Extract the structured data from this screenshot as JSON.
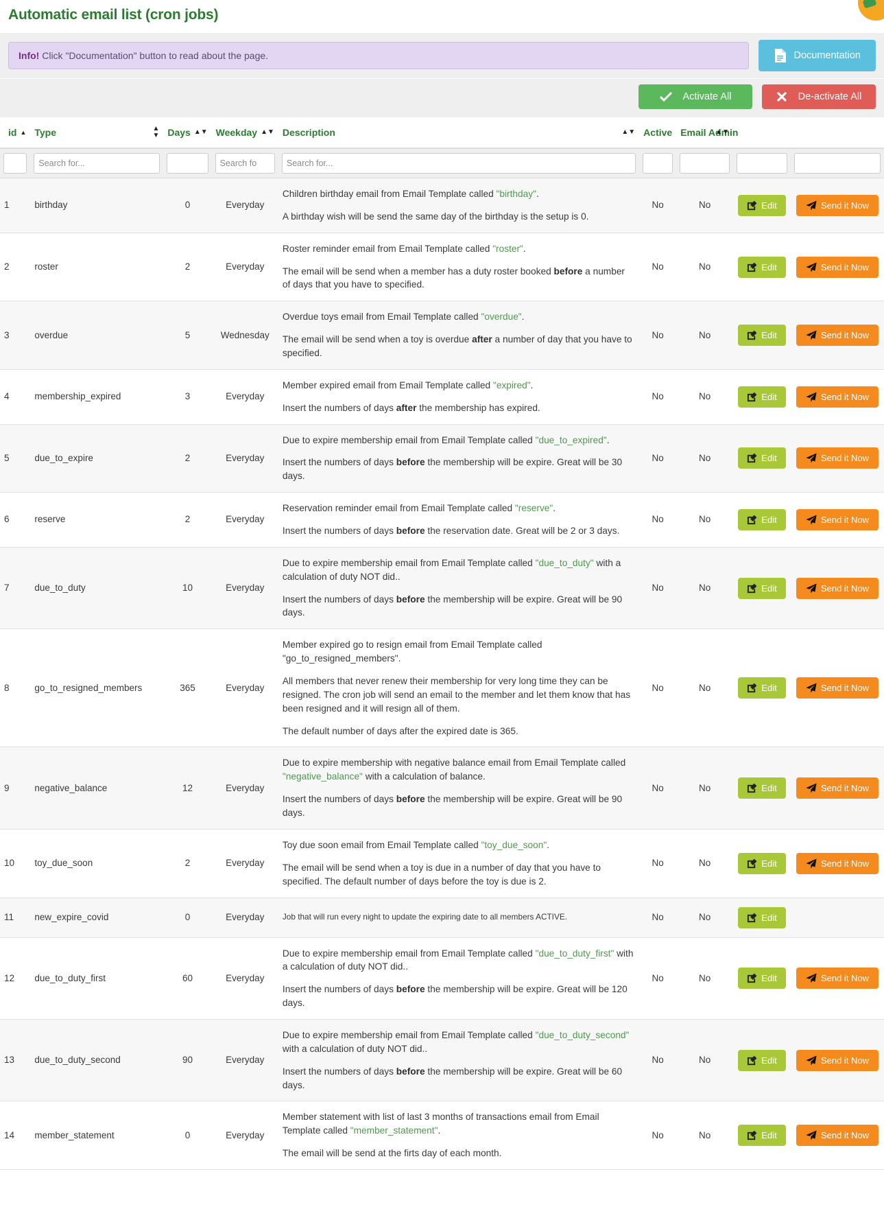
{
  "page": {
    "title": "Automatic email list (cron jobs)",
    "corner_badge_icon": "notification-badge-icon"
  },
  "alert": {
    "prefix": "Info!",
    "message": " Click \"Documentation\" button to read about the page."
  },
  "toolbar": {
    "documentation_label": "Documentation",
    "documentation_icon": "document-icon",
    "activate_all_label": "Activate All",
    "activate_all_icon": "check-icon",
    "deactivate_all_label": "De-activate All",
    "deactivate_all_icon": "cross-icon"
  },
  "table": {
    "headers": {
      "id": "id",
      "type": "Type",
      "days": "Days",
      "weekday": "Weekday",
      "description": "Description",
      "active": "Active",
      "email_admin": "Email Admin"
    },
    "filters": {
      "id_placeholder": "",
      "type_placeholder": "Search for...",
      "days_placeholder": "",
      "weekday_placeholder": "Search fo",
      "description_placeholder": "Search for...",
      "active_placeholder": "",
      "email_admin_placeholder": "",
      "edit_placeholder": "",
      "send_placeholder": ""
    },
    "row_buttons": {
      "edit_label": "Edit",
      "edit_icon": "pencil-square-icon",
      "send_label": "Send it Now",
      "send_icon": "paper-plane-icon"
    },
    "rows": [
      {
        "id": "1",
        "type": "birthday",
        "days": "0",
        "weekday": "Everyday",
        "description_lines": [
          [
            {
              "t": "Children birthday email from Email Template called "
            },
            {
              "t": "\"birthday\"",
              "s": "tpl"
            },
            {
              "t": "."
            }
          ],
          [
            {
              "t": "A birthday wish will be send the same day of the birthday is the setup is 0."
            }
          ]
        ],
        "active": "No",
        "email_admin": "No",
        "has_send": true,
        "small": false
      },
      {
        "id": "2",
        "type": "roster",
        "days": "2",
        "weekday": "Everyday",
        "description_lines": [
          [
            {
              "t": "Roster reminder email from Email Template called "
            },
            {
              "t": "\"roster\"",
              "s": "tpl"
            },
            {
              "t": "."
            }
          ],
          [
            {
              "t": "The email will be send when a member has a duty roster booked "
            },
            {
              "t": "before",
              "s": "b"
            },
            {
              "t": " a number of days that you have to specified."
            }
          ]
        ],
        "active": "No",
        "email_admin": "No",
        "has_send": true,
        "small": false
      },
      {
        "id": "3",
        "type": "overdue",
        "days": "5",
        "weekday": "Wednesday",
        "description_lines": [
          [
            {
              "t": "Overdue toys email from Email Template called "
            },
            {
              "t": "\"overdue\"",
              "s": "tpl"
            },
            {
              "t": "."
            }
          ],
          [
            {
              "t": "The email will be send when a toy is overdue "
            },
            {
              "t": "after",
              "s": "b"
            },
            {
              "t": " a number of day that you have to specified."
            }
          ]
        ],
        "active": "No",
        "email_admin": "No",
        "has_send": true,
        "small": false
      },
      {
        "id": "4",
        "type": "membership_expired",
        "days": "3",
        "weekday": "Everyday",
        "description_lines": [
          [
            {
              "t": "Member expired email from Email Template called "
            },
            {
              "t": "\"expired\"",
              "s": "tpl"
            },
            {
              "t": "."
            }
          ],
          [
            {
              "t": "Insert the numbers of days "
            },
            {
              "t": "after",
              "s": "b"
            },
            {
              "t": " the membership has expired."
            }
          ]
        ],
        "active": "No",
        "email_admin": "No",
        "has_send": true,
        "small": false
      },
      {
        "id": "5",
        "type": "due_to_expire",
        "days": "2",
        "weekday": "Everyday",
        "description_lines": [
          [
            {
              "t": "Due to expire membership email from Email Template called "
            },
            {
              "t": "\"due_to_expired\"",
              "s": "tpl"
            },
            {
              "t": "."
            }
          ],
          [
            {
              "t": "Insert the numbers of days "
            },
            {
              "t": "before",
              "s": "b"
            },
            {
              "t": " the membership will be expire. Great will be 30 days."
            }
          ]
        ],
        "active": "No",
        "email_admin": "No",
        "has_send": true,
        "small": false
      },
      {
        "id": "6",
        "type": "reserve",
        "days": "2",
        "weekday": "Everyday",
        "description_lines": [
          [
            {
              "t": "Reservation reminder email from Email Template called "
            },
            {
              "t": "\"reserve\"",
              "s": "tpl"
            },
            {
              "t": "."
            }
          ],
          [
            {
              "t": "Insert the numbers of days "
            },
            {
              "t": "before",
              "s": "b"
            },
            {
              "t": " the reservation date. Great will be 2 or 3 days."
            }
          ]
        ],
        "active": "No",
        "email_admin": "No",
        "has_send": true,
        "small": false
      },
      {
        "id": "7",
        "type": "due_to_duty",
        "days": "10",
        "weekday": "Everyday",
        "description_lines": [
          [
            {
              "t": "Due to expire membership email from Email Template called "
            },
            {
              "t": "\"due_to_duty\"",
              "s": "tpl"
            },
            {
              "t": " with a calculation of duty NOT did.."
            }
          ],
          [
            {
              "t": "Insert the numbers of days "
            },
            {
              "t": "before",
              "s": "b"
            },
            {
              "t": " the membership will be expire. Great will be 90 days."
            }
          ]
        ],
        "active": "No",
        "email_admin": "No",
        "has_send": true,
        "small": false
      },
      {
        "id": "8",
        "type": "go_to_resigned_members",
        "days": "365",
        "weekday": "Everyday",
        "description_lines": [
          [
            {
              "t": "Member expired go to resign email from Email Template called \"go_to_resigned_members\"."
            }
          ],
          [
            {
              "t": "All members that never renew their membership for very long time they can be resigned. The cron job will send an email to the member and let them know that has been resigned and it will resign all of them."
            }
          ],
          [
            {
              "t": "The default number of days after the expired date is 365."
            }
          ]
        ],
        "active": "No",
        "email_admin": "No",
        "has_send": true,
        "small": false
      },
      {
        "id": "9",
        "type": "negative_balance",
        "days": "12",
        "weekday": "Everyday",
        "description_lines": [
          [
            {
              "t": "Due to expire membership with negative balance email from Email Template called "
            },
            {
              "t": "\"negative_balance\"",
              "s": "tpl"
            },
            {
              "t": " with a calculation of balance."
            }
          ],
          [
            {
              "t": "Insert the numbers of days "
            },
            {
              "t": "before",
              "s": "b"
            },
            {
              "t": " the membership will be expire. Great will be 90 days."
            }
          ]
        ],
        "active": "No",
        "email_admin": "No",
        "has_send": true,
        "small": false
      },
      {
        "id": "10",
        "type": "toy_due_soon",
        "days": "2",
        "weekday": "Everyday",
        "description_lines": [
          [
            {
              "t": "Toy due soon email from Email Template called "
            },
            {
              "t": "\"toy_due_soon\"",
              "s": "tpl"
            },
            {
              "t": "."
            }
          ],
          [
            {
              "t": "The email will be send when a toy is due in a number of day that you have to specified. The default number of days before the toy is due is 2."
            }
          ]
        ],
        "active": "No",
        "email_admin": "No",
        "has_send": true,
        "small": false
      },
      {
        "id": "11",
        "type": "new_expire_covid",
        "days": "0",
        "weekday": "Everyday",
        "description_lines": [
          [
            {
              "t": "Job that will run every night to update the expiring date to all members ACTIVE."
            }
          ]
        ],
        "active": "No",
        "email_admin": "No",
        "has_send": false,
        "small": true
      },
      {
        "id": "12",
        "type": "due_to_duty_first",
        "days": "60",
        "weekday": "Everyday",
        "description_lines": [
          [
            {
              "t": "Due to expire membership email from Email Template called "
            },
            {
              "t": "\"due_to_duty_first\"",
              "s": "tpl"
            },
            {
              "t": " with a calculation of duty NOT did.."
            }
          ],
          [
            {
              "t": "Insert the numbers of days "
            },
            {
              "t": "before",
              "s": "b"
            },
            {
              "t": " the membership will be expire. Great will be 120 days."
            }
          ]
        ],
        "active": "No",
        "email_admin": "No",
        "has_send": true,
        "small": false
      },
      {
        "id": "13",
        "type": "due_to_duty_second",
        "days": "90",
        "weekday": "Everyday",
        "description_lines": [
          [
            {
              "t": "Due to expire membership email from Email Template called "
            },
            {
              "t": "\"due_to_duty_second\"",
              "s": "tpl"
            },
            {
              "t": " with a calculation of duty NOT did.."
            }
          ],
          [
            {
              "t": "Insert the numbers of days "
            },
            {
              "t": "before",
              "s": "b"
            },
            {
              "t": " the membership will be expire. Great will be 60 days."
            }
          ]
        ],
        "active": "No",
        "email_admin": "No",
        "has_send": true,
        "small": false
      },
      {
        "id": "14",
        "type": "member_statement",
        "days": "0",
        "weekday": "Everyday",
        "description_lines": [
          [
            {
              "t": "Member statement with list of last 3 months of transactions email from Email Template called "
            },
            {
              "t": "\"member_statement\"",
              "s": "tpl"
            },
            {
              "t": "."
            }
          ],
          [
            {
              "t": "The email will be send at the firts day of each month."
            }
          ]
        ],
        "active": "No",
        "email_admin": "No",
        "has_send": true,
        "small": false
      }
    ]
  },
  "colors": {
    "title_green": "#2a7d2e",
    "info_purple": "#e2d6f2",
    "doc_blue": "#5bc0de",
    "activate_green": "#5cb85c",
    "deactivate_red": "#e05c56",
    "edit_green": "#a8c838",
    "send_orange": "#f58b1f",
    "template_green": "#4d9a4d"
  }
}
